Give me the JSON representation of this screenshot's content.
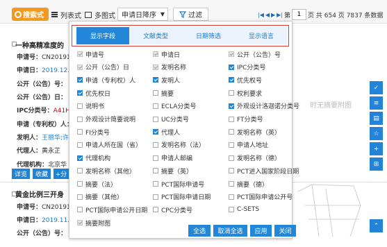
{
  "toolbar": {
    "logo_label": "搜索式",
    "list_view": "列表式",
    "grid_view": "多图式",
    "sort_value": "申请日降序",
    "filter_label": "过滤",
    "page_prefix": "第",
    "page_value": "1",
    "page_suffix": "页 共 654 页 7837 条数据"
  },
  "results": [
    {
      "title": "一种高精准度的",
      "fields": [
        {
          "label": "申请号：",
          "value": "CN20191",
          "color": "#333333"
        },
        {
          "label": "申请日：",
          "value": "2019.12.",
          "color": "#1e7ac9"
        },
        {
          "label": "公开（公告）号：",
          "value": "",
          "color": "#333333"
        },
        {
          "label": "公开（公告）日：",
          "value": "",
          "color": "#333333"
        },
        {
          "label": "IPC分类号：",
          "value": "A41H",
          "color": "#d0021b"
        },
        {
          "label": "申请（专利权）人：",
          "value": "",
          "color": "#333333"
        },
        {
          "label": "发明人：",
          "value": "王丽华;许",
          "color": "#1e7ac9"
        },
        {
          "label": "代理人：",
          "value": "黄永芷",
          "color": "#333333"
        },
        {
          "label": "代理机构：",
          "value": "北京华",
          "color": "#333333"
        }
      ],
      "actions": [
        "详览",
        "收藏",
        "+分"
      ]
    },
    {
      "title": "黄金比例三开身",
      "fields": [
        {
          "label": "申请号：",
          "value": "CN20191",
          "color": "#333333"
        },
        {
          "label": "申请日：",
          "value": "2019.11.",
          "color": "#1e7ac9"
        },
        {
          "label": "公开（公告）号：",
          "value": "",
          "color": "#333333"
        }
      ]
    }
  ],
  "no_image_text": "时无摘要附图",
  "side_icons": [
    "check-icon",
    "list-icon",
    "doc-icon",
    "star-icon",
    "plus-icon",
    "add-box-icon",
    "chevron-up-icon"
  ],
  "panel": {
    "tabs": [
      {
        "label": "显示字段",
        "active": true
      },
      {
        "label": "文献类型",
        "active": false
      },
      {
        "label": "日期筛选",
        "active": false
      },
      {
        "label": "显示语言",
        "active": false
      }
    ],
    "options": [
      {
        "label": "申请号",
        "state": "disabled"
      },
      {
        "label": "申请日",
        "state": "disabled"
      },
      {
        "label": "公开（公告）号",
        "state": "disabled"
      },
      {
        "label": "公开（公告）日",
        "state": "disabled"
      },
      {
        "label": "发明名称",
        "state": "disabled"
      },
      {
        "label": "IPC分类号",
        "state": "checked"
      },
      {
        "label": "申请（专利权）人",
        "state": "checked"
      },
      {
        "label": "发明人",
        "state": "checked"
      },
      {
        "label": "优先权号",
        "state": "checked"
      },
      {
        "label": "优先权日",
        "state": "checked"
      },
      {
        "label": "摘要",
        "state": "unchecked"
      },
      {
        "label": "权利要求",
        "state": "unchecked"
      },
      {
        "label": "说明书",
        "state": "unchecked"
      },
      {
        "label": "ECLA分类号",
        "state": "unchecked"
      },
      {
        "label": "外观设计洛迦诺分类号",
        "state": "checked"
      },
      {
        "label": "外观设计简要说明",
        "state": "unchecked"
      },
      {
        "label": "UC分类号",
        "state": "unchecked"
      },
      {
        "label": "FT分类号",
        "state": "unchecked"
      },
      {
        "label": "FI分类号",
        "state": "unchecked"
      },
      {
        "label": "代理人",
        "state": "checked"
      },
      {
        "label": "发明名称（英）",
        "state": "unchecked"
      },
      {
        "label": "申请人所在国（省）",
        "state": "unchecked"
      },
      {
        "label": "发明名称（法）",
        "state": "unchecked"
      },
      {
        "label": "申请人地址",
        "state": "unchecked"
      },
      {
        "label": "代理机构",
        "state": "checked"
      },
      {
        "label": "申请人邮编",
        "state": "unchecked"
      },
      {
        "label": "发明名称（德）",
        "state": "unchecked"
      },
      {
        "label": "发明名称（其他）",
        "state": "unchecked"
      },
      {
        "label": "摘要（英）",
        "state": "unchecked"
      },
      {
        "label": "PCT进入国家阶段日期",
        "state": "unchecked"
      },
      {
        "label": "摘要（法）",
        "state": "unchecked"
      },
      {
        "label": "PCT国际申请号",
        "state": "unchecked"
      },
      {
        "label": "摘要（德）",
        "state": "unchecked"
      },
      {
        "label": "摘要（其他）",
        "state": "unchecked"
      },
      {
        "label": "PCT国际申请日期",
        "state": "unchecked"
      },
      {
        "label": "PCT国际申请公开号",
        "state": "unchecked"
      },
      {
        "label": "PCT国际申请公开日期",
        "state": "unchecked"
      },
      {
        "label": "CPC分类号",
        "state": "unchecked"
      },
      {
        "label": "C-SETS",
        "state": "unchecked"
      },
      {
        "label": "摘要附图",
        "state": "disabled"
      }
    ],
    "buttons": [
      "全选",
      "取消全选",
      "应用",
      "关闭"
    ]
  },
  "colors": {
    "accent": "#2287d9",
    "logo": "#f39a1e",
    "highlight_border": "#d53a3a"
  }
}
